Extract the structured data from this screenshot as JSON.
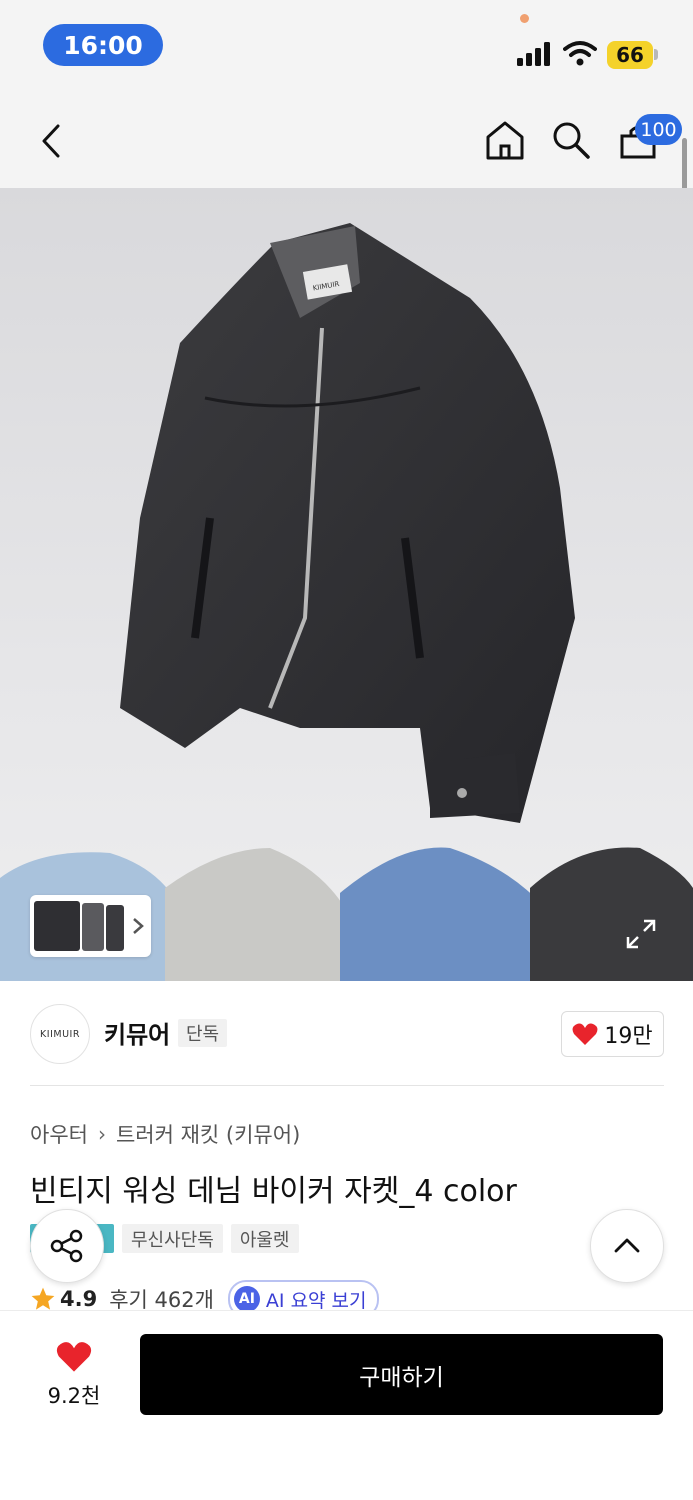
{
  "status_bar": {
    "time": "16:00",
    "battery": "66"
  },
  "nav": {
    "cart_count": "100"
  },
  "gallery": {
    "thumb_brand": "KIIMUIR"
  },
  "brand": {
    "logo_text": "KIIMUIR",
    "name": "키뮤어",
    "exclusive_tag": "단독",
    "likes": "19만"
  },
  "breadcrumb": {
    "category": "아우터",
    "subcategory": "트러커 재킷 (키뮤어)"
  },
  "product": {
    "title": "빈티지 워싱 데님 바이커 자켓_4 color",
    "tags": [
      "무신사단독",
      "아울렛"
    ],
    "rating": "4.9",
    "reviews": "후기 462개",
    "ai_chip": "AI",
    "ai_summary": "AI 요약 보기"
  },
  "bottom": {
    "likes": "9.2천",
    "buy_label": "구매하기"
  },
  "colors": {
    "accent": "#2c6be0",
    "heart": "#e8242c",
    "star": "#f5a623",
    "buy_bg": "#000000"
  }
}
